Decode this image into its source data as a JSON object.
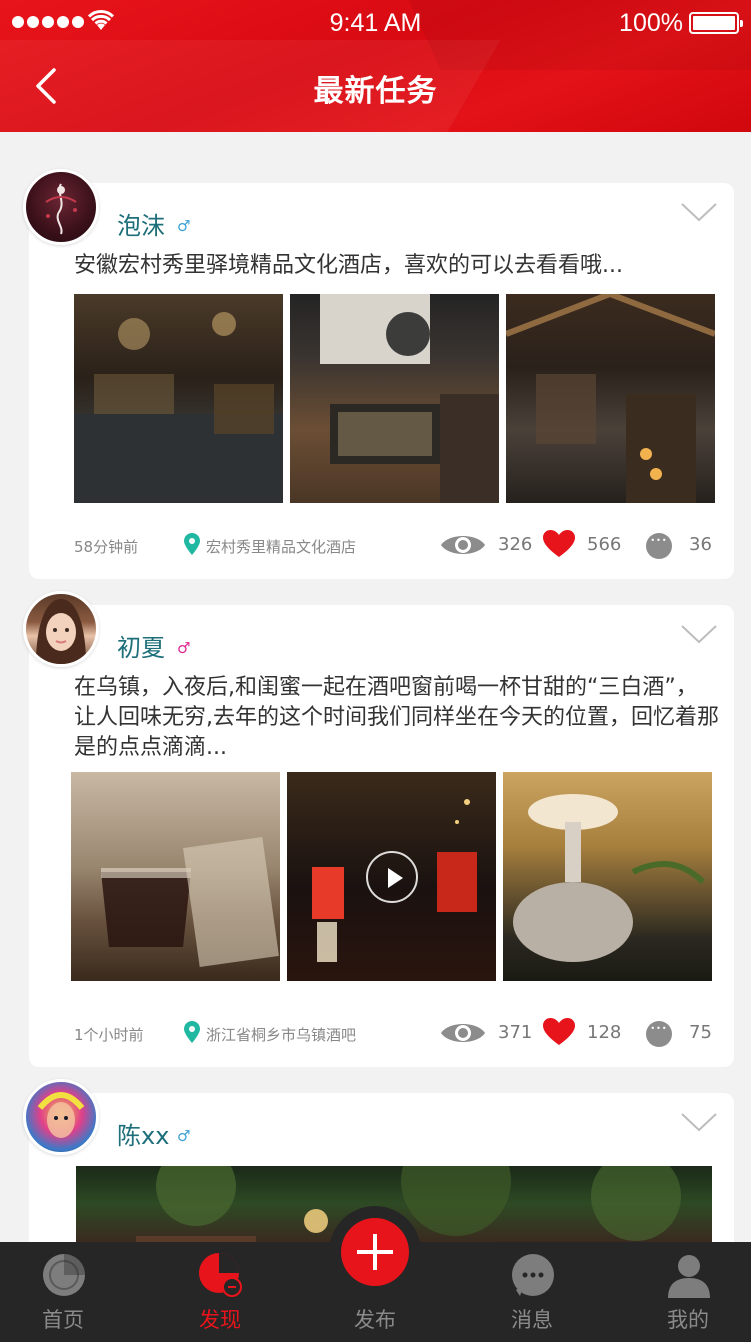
{
  "status": {
    "time": "9:41 AM",
    "battery": "100%"
  },
  "header": {
    "title": "最新任务"
  },
  "posts": [
    {
      "name": "泡沫",
      "gender": "♂",
      "text": "安徽宏村秀里驿境精品文化酒店，喜欢的可以去看看哦...",
      "time": "58分钟前",
      "location": "宏村秀里精品文化酒店",
      "views": "326",
      "likes": "566",
      "comments": "36"
    },
    {
      "name": "初夏",
      "gender": "♂",
      "text": "在乌镇，入夜后,和闺蜜一起在酒吧窗前喝一杯甘甜的“三白酒”，让人回味无穷,去年的这个时间我们同样坐在今天的位置，回忆着那是的点点滴滴...",
      "time": "1个小时前",
      "location": "浙江省桐乡市乌镇酒吧",
      "views": "371",
      "likes": "128",
      "comments": "75"
    },
    {
      "name": "陈xx",
      "gender": "♂"
    }
  ],
  "tabs": {
    "home": "首页",
    "discover": "发现",
    "publish": "发布",
    "messages": "消息",
    "mine": "我的"
  },
  "colors": {
    "brand_red": "#e8141b",
    "name_teal": "#1e6f7a",
    "male_blue": "#3aa0d8",
    "female_pink": "#e0268f",
    "pin_teal": "#21b8a2"
  }
}
